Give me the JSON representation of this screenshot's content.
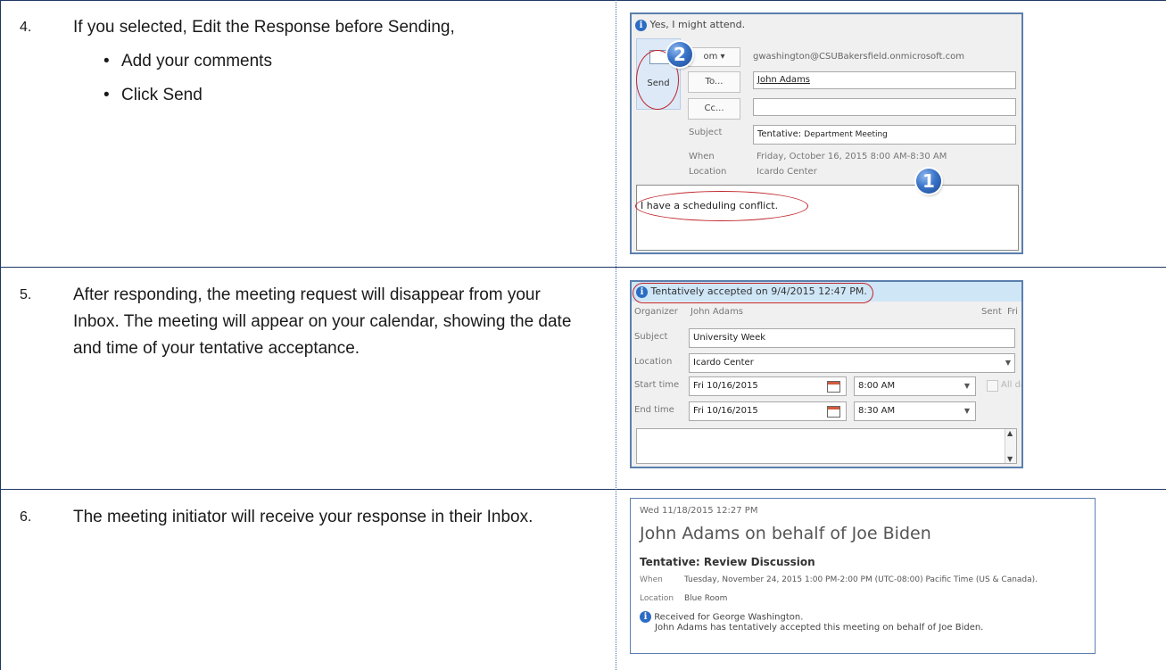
{
  "steps": [
    {
      "number": "4.",
      "text": "If you selected, Edit the Response before Sending,",
      "bullets": [
        "Add your comments",
        "Click Send"
      ]
    },
    {
      "number": "5.",
      "text": "After responding, the meeting request will disappear from your Inbox. The meeting will appear on your calendar, showing the date and time of your tentative acceptance."
    },
    {
      "number": "6.",
      "text": "The meeting initiator will receive your response in their Inbox."
    }
  ],
  "shot1": {
    "banner": "Yes, I might attend.",
    "send_label": "Send",
    "from_label": "om",
    "from_value": "gwashington@CSUBakersfield.onmicrosoft.com",
    "to_label": "To...",
    "to_value": "John Adams",
    "cc_label": "Cc...",
    "subject_label": "Subject",
    "subject_prefix": "Tentative:",
    "subject_value": "Department Meeting",
    "when_label": "When",
    "when_value": "Friday, October 16, 2015 8:00 AM-8:30 AM",
    "location_label": "Location",
    "location_value": "Icardo Center",
    "body_text": "I have a scheduling conflict.",
    "badge1": "1",
    "badge2": "2"
  },
  "shot2": {
    "banner": "Tentatively accepted on 9/4/2015 12:47 PM.",
    "organizer_label": "Organizer",
    "organizer_value": "John Adams",
    "sent_label": "Sent",
    "sent_value": "Fri",
    "subject_label": "Subject",
    "subject_value": "University Week",
    "location_label": "Location",
    "location_value": "Icardo Center",
    "start_label": "Start time",
    "start_date": "Fri 10/16/2015",
    "start_time": "8:00 AM",
    "allday_label": "All day e",
    "end_label": "End time",
    "end_date": "Fri 10/16/2015",
    "end_time": "8:30 AM"
  },
  "shot3": {
    "date": "Wed 11/18/2015 12:27 PM",
    "sender": "John Adams on behalf of Joe Biden",
    "subject": "Tentative: Review Discussion",
    "when_label": "When",
    "when_value": "Tuesday, November 24, 2015 1:00 PM-2:00 PM (UTC-08:00) Pacific Time (US & Canada).",
    "location_label": "Location",
    "location_value": "Blue Room",
    "info_line1": "Received for George Washington.",
    "info_line2": "John Adams has tentatively accepted this meeting on behalf of Joe Biden."
  },
  "colors": {
    "border_blue": "#1f3864",
    "annotation_red": "#c0272d",
    "banner_blue": "#cfe6f7",
    "panel_gray": "#f0f0f0"
  },
  "icons": [
    "info-icon",
    "send-envelope-icon",
    "calendar-icon",
    "dropdown-arrow-icon",
    "scroll-arrow-icon"
  ]
}
